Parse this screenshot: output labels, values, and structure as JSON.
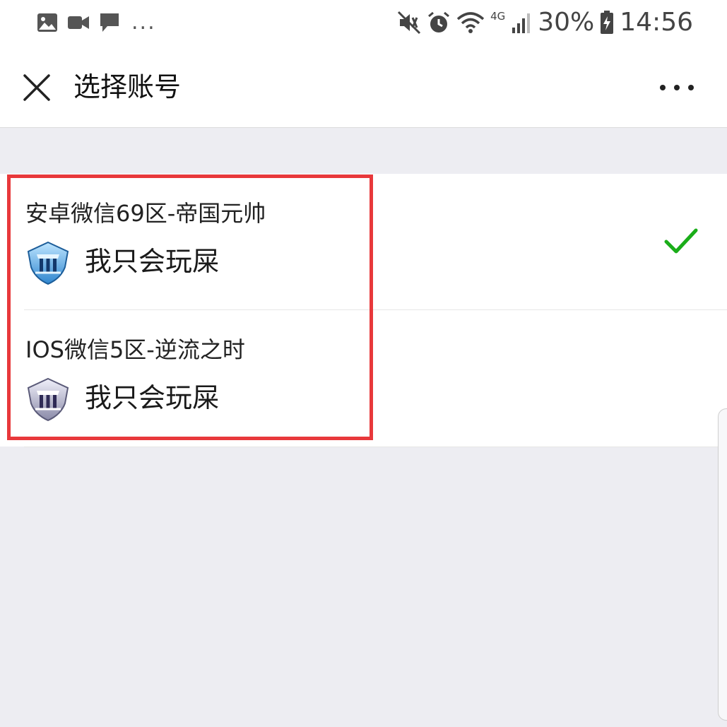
{
  "status_bar": {
    "notification_icons": [
      "image-icon",
      "video-icon",
      "chat-icon"
    ],
    "more_notifications": "...",
    "network_label": "4G",
    "battery_percent": "30%",
    "time": "14:56"
  },
  "header": {
    "close_icon": "close-icon",
    "title": "选择账号",
    "more_icon": "more-icon"
  },
  "accounts": [
    {
      "server": "安卓微信69区-帝国元帅",
      "role_name": "我只会玩屎",
      "selected": true,
      "badge_color": "#4aa8e8"
    },
    {
      "server": "IOS微信5区-逆流之时",
      "role_name": "我只会玩屎",
      "selected": false,
      "badge_color": "#8a8aa8"
    }
  ],
  "colors": {
    "check": "#1aad19",
    "highlight": "#e8383b",
    "background": "#ededf2"
  }
}
